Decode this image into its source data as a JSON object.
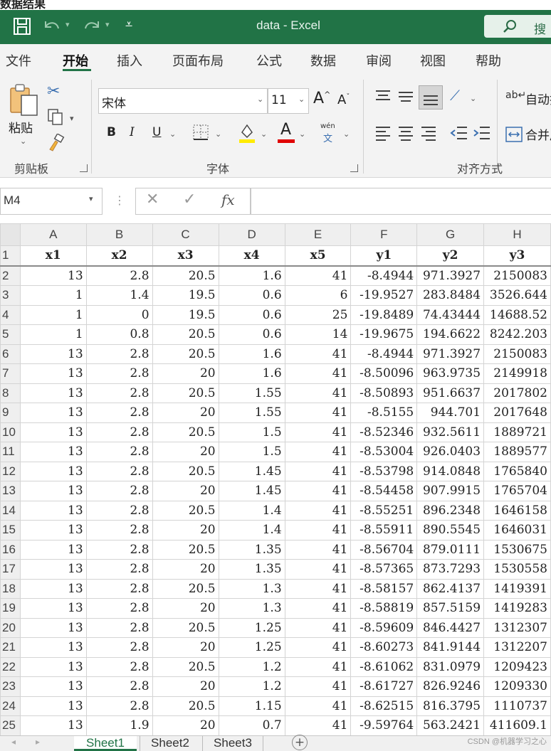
{
  "page_caption": "数据结果",
  "titlebar": {
    "doc_title": "data  -  Excel",
    "search_label": "搜索",
    "accent": "#217346"
  },
  "ribbon_tabs": [
    "文件",
    "开始",
    "插入",
    "页面布局",
    "公式",
    "数据",
    "审阅",
    "视图",
    "帮助"
  ],
  "active_tab": "开始",
  "ribbon": {
    "clipboard": {
      "paste_label": "粘贴",
      "group_label": "剪贴板"
    },
    "font": {
      "font_name": "宋体",
      "font_size": "11",
      "group_label": "字体",
      "bold": "B",
      "italic": "I",
      "underline": "U",
      "grow": "A",
      "shrink": "A",
      "font_color_glyph": "A",
      "phonetic_top": "wén",
      "phonetic_bottom": "文",
      "fill_color": "#ffeb00",
      "font_color": "#e00000"
    },
    "alignment": {
      "group_label": "对齐方式",
      "wrap_label": "自动换行",
      "merge_label": "合并后居中"
    }
  },
  "formula_bar": {
    "name_box": "M4",
    "fx": "fx",
    "formula": ""
  },
  "columns": [
    "A",
    "B",
    "C",
    "D",
    "E",
    "F",
    "G",
    "H"
  ],
  "header_row": [
    "x1",
    "x2",
    "x3",
    "x4",
    "x5",
    "y1",
    "y2",
    "y3"
  ],
  "rows": [
    [
      "13",
      "2.8",
      "20.5",
      "1.6",
      "41",
      "-8.4944",
      "971.3927",
      "2150083"
    ],
    [
      "1",
      "1.4",
      "19.5",
      "0.6",
      "6",
      "-19.9527",
      "283.8484",
      "3526.644"
    ],
    [
      "1",
      "0",
      "19.5",
      "0.6",
      "25",
      "-19.8489",
      "74.43444",
      "14688.52"
    ],
    [
      "1",
      "0.8",
      "20.5",
      "0.6",
      "14",
      "-19.9675",
      "194.6622",
      "8242.203"
    ],
    [
      "13",
      "2.8",
      "20.5",
      "1.6",
      "41",
      "-8.4944",
      "971.3927",
      "2150083"
    ],
    [
      "13",
      "2.8",
      "20",
      "1.6",
      "41",
      "-8.50096",
      "963.9735",
      "2149918"
    ],
    [
      "13",
      "2.8",
      "20.5",
      "1.55",
      "41",
      "-8.50893",
      "951.6637",
      "2017802"
    ],
    [
      "13",
      "2.8",
      "20",
      "1.55",
      "41",
      "-8.5155",
      "944.701",
      "2017648"
    ],
    [
      "13",
      "2.8",
      "20.5",
      "1.5",
      "41",
      "-8.52346",
      "932.5611",
      "1889721"
    ],
    [
      "13",
      "2.8",
      "20",
      "1.5",
      "41",
      "-8.53004",
      "926.0403",
      "1889577"
    ],
    [
      "13",
      "2.8",
      "20.5",
      "1.45",
      "41",
      "-8.53798",
      "914.0848",
      "1765840"
    ],
    [
      "13",
      "2.8",
      "20",
      "1.45",
      "41",
      "-8.54458",
      "907.9915",
      "1765704"
    ],
    [
      "13",
      "2.8",
      "20.5",
      "1.4",
      "41",
      "-8.55251",
      "896.2348",
      "1646158"
    ],
    [
      "13",
      "2.8",
      "20",
      "1.4",
      "41",
      "-8.55911",
      "890.5545",
      "1646031"
    ],
    [
      "13",
      "2.8",
      "20.5",
      "1.35",
      "41",
      "-8.56704",
      "879.0111",
      "1530675"
    ],
    [
      "13",
      "2.8",
      "20",
      "1.35",
      "41",
      "-8.57365",
      "873.7293",
      "1530558"
    ],
    [
      "13",
      "2.8",
      "20.5",
      "1.3",
      "41",
      "-8.58157",
      "862.4137",
      "1419391"
    ],
    [
      "13",
      "2.8",
      "20",
      "1.3",
      "41",
      "-8.58819",
      "857.5159",
      "1419283"
    ],
    [
      "13",
      "2.8",
      "20.5",
      "1.25",
      "41",
      "-8.59609",
      "846.4427",
      "1312307"
    ],
    [
      "13",
      "2.8",
      "20",
      "1.25",
      "41",
      "-8.60273",
      "841.9144",
      "1312207"
    ],
    [
      "13",
      "2.8",
      "20.5",
      "1.2",
      "41",
      "-8.61062",
      "831.0979",
      "1209423"
    ],
    [
      "13",
      "2.8",
      "20",
      "1.2",
      "41",
      "-8.61727",
      "826.9246",
      "1209330"
    ],
    [
      "13",
      "2.8",
      "20.5",
      "1.15",
      "41",
      "-8.62515",
      "816.3795",
      "1110737"
    ],
    [
      "13",
      "1.9",
      "20",
      "0.7",
      "41",
      "-9.59764",
      "563.2421",
      "411609.1"
    ]
  ],
  "sheets": [
    "Sheet1",
    "Sheet2",
    "Sheet3"
  ],
  "active_sheet": "Sheet1",
  "add_sheet_glyph": "+",
  "watermark": "CSDN @机器学习之心"
}
